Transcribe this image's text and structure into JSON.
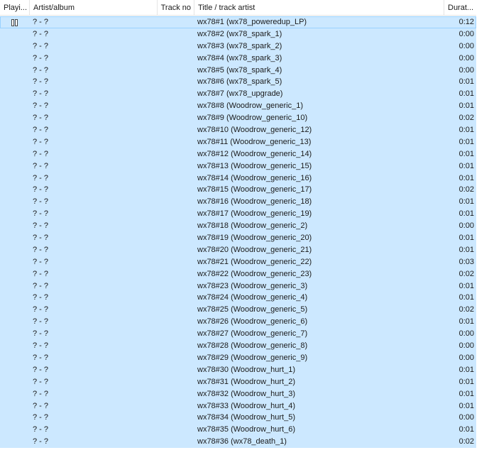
{
  "columns": {
    "playing": "Playi...",
    "artist_album": "Artist/album",
    "track_no": "Track no",
    "title_artist": "Title / track artist",
    "duration": "Durat..."
  },
  "playing_icon": "pause-icon",
  "colors": {
    "selection": "#cce8ff",
    "focus_border": "#99d1ff"
  },
  "rows": [
    {
      "artist": "? - ?",
      "track": "",
      "title": "wx78#1 (wx78_poweredup_LP)",
      "duration": "0:12"
    },
    {
      "artist": "? - ?",
      "track": "",
      "title": "wx78#2 (wx78_spark_1)",
      "duration": "0:00"
    },
    {
      "artist": "? - ?",
      "track": "",
      "title": "wx78#3 (wx78_spark_2)",
      "duration": "0:00"
    },
    {
      "artist": "? - ?",
      "track": "",
      "title": "wx78#4 (wx78_spark_3)",
      "duration": "0:00"
    },
    {
      "artist": "? - ?",
      "track": "",
      "title": "wx78#5 (wx78_spark_4)",
      "duration": "0:00"
    },
    {
      "artist": "? - ?",
      "track": "",
      "title": "wx78#6 (wx78_spark_5)",
      "duration": "0:01"
    },
    {
      "artist": "? - ?",
      "track": "",
      "title": "wx78#7 (wx78_upgrade)",
      "duration": "0:01"
    },
    {
      "artist": "? - ?",
      "track": "",
      "title": "wx78#8 (Woodrow_generic_1)",
      "duration": "0:01"
    },
    {
      "artist": "? - ?",
      "track": "",
      "title": "wx78#9 (Woodrow_generic_10)",
      "duration": "0:02"
    },
    {
      "artist": "? - ?",
      "track": "",
      "title": "wx78#10 (Woodrow_generic_12)",
      "duration": "0:01"
    },
    {
      "artist": "? - ?",
      "track": "",
      "title": "wx78#11 (Woodrow_generic_13)",
      "duration": "0:01"
    },
    {
      "artist": "? - ?",
      "track": "",
      "title": "wx78#12 (Woodrow_generic_14)",
      "duration": "0:01"
    },
    {
      "artist": "? - ?",
      "track": "",
      "title": "wx78#13 (Woodrow_generic_15)",
      "duration": "0:01"
    },
    {
      "artist": "? - ?",
      "track": "",
      "title": "wx78#14 (Woodrow_generic_16)",
      "duration": "0:01"
    },
    {
      "artist": "? - ?",
      "track": "",
      "title": "wx78#15 (Woodrow_generic_17)",
      "duration": "0:02"
    },
    {
      "artist": "? - ?",
      "track": "",
      "title": "wx78#16 (Woodrow_generic_18)",
      "duration": "0:01"
    },
    {
      "artist": "? - ?",
      "track": "",
      "title": "wx78#17 (Woodrow_generic_19)",
      "duration": "0:01"
    },
    {
      "artist": "? - ?",
      "track": "",
      "title": "wx78#18 (Woodrow_generic_2)",
      "duration": "0:00"
    },
    {
      "artist": "? - ?",
      "track": "",
      "title": "wx78#19 (Woodrow_generic_20)",
      "duration": "0:01"
    },
    {
      "artist": "? - ?",
      "track": "",
      "title": "wx78#20 (Woodrow_generic_21)",
      "duration": "0:01"
    },
    {
      "artist": "? - ?",
      "track": "",
      "title": "wx78#21 (Woodrow_generic_22)",
      "duration": "0:03"
    },
    {
      "artist": "? - ?",
      "track": "",
      "title": "wx78#22 (Woodrow_generic_23)",
      "duration": "0:02"
    },
    {
      "artist": "? - ?",
      "track": "",
      "title": "wx78#23 (Woodrow_generic_3)",
      "duration": "0:01"
    },
    {
      "artist": "? - ?",
      "track": "",
      "title": "wx78#24 (Woodrow_generic_4)",
      "duration": "0:01"
    },
    {
      "artist": "? - ?",
      "track": "",
      "title": "wx78#25 (Woodrow_generic_5)",
      "duration": "0:02"
    },
    {
      "artist": "? - ?",
      "track": "",
      "title": "wx78#26 (Woodrow_generic_6)",
      "duration": "0:01"
    },
    {
      "artist": "? - ?",
      "track": "",
      "title": "wx78#27 (Woodrow_generic_7)",
      "duration": "0:00"
    },
    {
      "artist": "? - ?",
      "track": "",
      "title": "wx78#28 (Woodrow_generic_8)",
      "duration": "0:00"
    },
    {
      "artist": "? - ?",
      "track": "",
      "title": "wx78#29 (Woodrow_generic_9)",
      "duration": "0:00"
    },
    {
      "artist": "? - ?",
      "track": "",
      "title": "wx78#30 (Woodrow_hurt_1)",
      "duration": "0:01"
    },
    {
      "artist": "? - ?",
      "track": "",
      "title": "wx78#31 (Woodrow_hurt_2)",
      "duration": "0:01"
    },
    {
      "artist": "? - ?",
      "track": "",
      "title": "wx78#32 (Woodrow_hurt_3)",
      "duration": "0:01"
    },
    {
      "artist": "? - ?",
      "track": "",
      "title": "wx78#33 (Woodrow_hurt_4)",
      "duration": "0:01"
    },
    {
      "artist": "? - ?",
      "track": "",
      "title": "wx78#34 (Woodrow_hurt_5)",
      "duration": "0:00"
    },
    {
      "artist": "? - ?",
      "track": "",
      "title": "wx78#35 (Woodrow_hurt_6)",
      "duration": "0:01"
    },
    {
      "artist": "? - ?",
      "track": "",
      "title": "wx78#36 (wx78_death_1)",
      "duration": "0:02"
    }
  ]
}
